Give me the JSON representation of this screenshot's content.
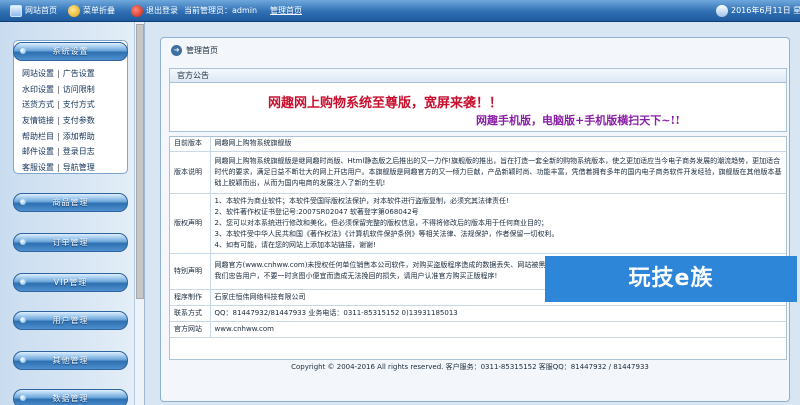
{
  "topbar": {
    "home": "网站首页",
    "menu": "菜单折叠",
    "logout": "退出登录",
    "admin_prefix": "当前管理员：admin",
    "manage_home": "管理首页",
    "date": "2016年6月11日 星"
  },
  "sidebar": {
    "groups": [
      "系统设置",
      "商品管理",
      "订单管理",
      "VIP管理",
      "用户管理",
      "其他管理",
      "数据管理"
    ],
    "system_items": [
      [
        "网站设置",
        "广告设置"
      ],
      [
        "水印设置",
        "访问限制"
      ],
      [
        "送货方式",
        "支付方式"
      ],
      [
        "友情链接",
        "支付参数"
      ],
      [
        "帮助栏目",
        "添加帮助"
      ],
      [
        "邮件设置",
        "登录日志"
      ],
      [
        "客服设置",
        "导航管理"
      ]
    ]
  },
  "main": {
    "breadcrumb": "管理首页",
    "notice_title": "官方公告",
    "banner_line1": "网趣网上购物系统至尊版，宽屏来袭！！",
    "banner_line2": "网趣手机版，电脑版+手机版横扫天下~!!",
    "info": {
      "version_label": "目前版本",
      "version_value": "网趣网上购物系统旗舰版",
      "desc_label": "版本说明",
      "desc_value": "网趣网上购物系统旗舰版是继网趣时尚版、Html静态版之后推出的又一力作!旗舰版的推出，旨在打造一套全新的购物系统版本，使之更加适应当今电子商务发展的潮流趋势，更加适合时代的要求，满足日益不断壮大的网上开店用户。本旗舰版是网趣官方的又一倾力巨献，产品新颖时尚、功能丰富，凭借着拥有多年的国内电子商务软件开发经验，旗舰版在其他版本基础上脱颖而出，从而为国内电商的发展注入了新的生机!",
      "copyright_label": "版权声明",
      "copyright_lines": [
        "1、本软件为商业软件；本软件受国际版权法保护，对本软件进行盗版复制，必须究其法律责任!",
        "2、软件著作权证书登记号:2007SR02047  软著登字第068042号",
        "2、您可以对本系统进行修改和美化，但必须保留完整的版权信息，不得将修改后的版本用于任何商业目的；",
        "3、本软件受中华人民共和国《著作权法》《计算机软件保护条例》等相关法律、法规保护，作者保留一切权利。",
        "4、如有可能，请在您的网站上添加本站链接，谢谢!"
      ],
      "special_label": "特别声明",
      "special_value": "网趣官方(www.cnhww.com)未授权任何单位销售本公司软件，对购买盗版程序造成的数据丢失、网站被黑等一切损失均与本公司无关，切勿贪小便宜造成数据丢失的案例比比皆是，我们忠告用户，不要一时贪图小便宜而造成无法挽回的损失，请用户认准官方购买正版程序!",
      "maker_label": "程序制作",
      "maker_value": "石家庄恒伟网络科技有限公司",
      "contact_label": "联系方式",
      "contact_value": "QQ：81447932/81447933  业务电话：0311-85315152  0)13931185013",
      "site_label": "官方网站",
      "site_value": "www.cnhww.com"
    },
    "footer": "Copyright © 2004-2016 All rights reserved. 客户服务：0311-85315152 客服QQ：81447932 / 81447933"
  },
  "watermark": "玩技e族",
  "colors": {
    "accent": "#2f6fb3",
    "banner_red": "#c8102e",
    "banner_purple": "#8a1fa6"
  }
}
